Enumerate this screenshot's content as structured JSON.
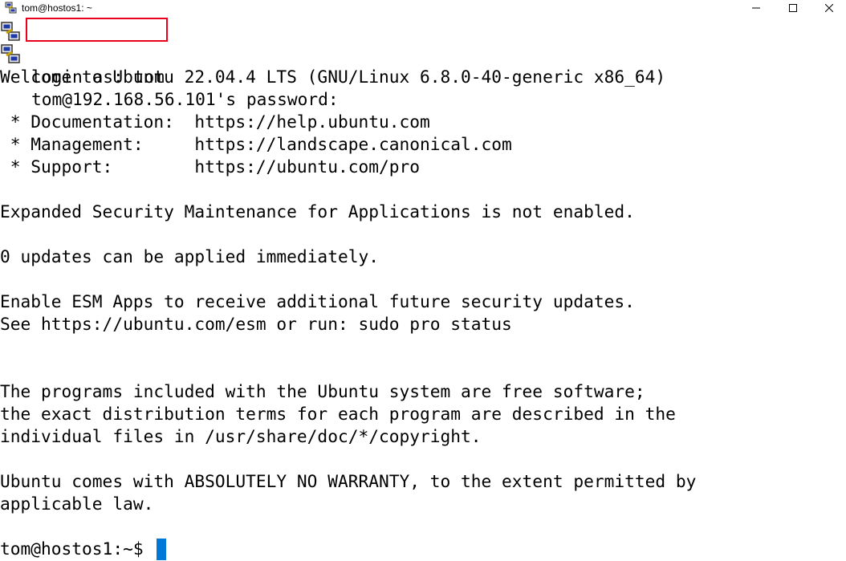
{
  "window": {
    "title": "tom@hostos1: ~"
  },
  "icons": {
    "app": "putty-icon",
    "minimize": "minimize-icon",
    "maximize": "maximize-icon",
    "close": "close-icon"
  },
  "colors": {
    "highlight": "#e8001c",
    "cursor": "#0078d7"
  },
  "terminal": {
    "login_prompt": "login as: tom",
    "password_prompt": "tom@192.168.56.101's password:",
    "welcome": "Welcome to Ubuntu 22.04.4 LTS (GNU/Linux 6.8.0-40-generic x86_64)",
    "doc": " * Documentation:  https://help.ubuntu.com",
    "mgmt": " * Management:     https://landscape.canonical.com",
    "support": " * Support:        https://ubuntu.com/pro",
    "esm": "Expanded Security Maintenance for Applications is not enabled.",
    "updates": "0 updates can be applied immediately.",
    "enable_esm": "Enable ESM Apps to receive additional future security updates.",
    "see_esm": "See https://ubuntu.com/esm or run: sudo pro status",
    "programs1": "The programs included with the Ubuntu system are free software;",
    "programs2": "the exact distribution terms for each program are described in the",
    "programs3": "individual files in /usr/share/doc/*/copyright.",
    "warranty1": "Ubuntu comes with ABSOLUTELY NO WARRANTY, to the extent permitted by",
    "warranty2": "applicable law.",
    "shell_prompt": "tom@hostos1:~$"
  }
}
